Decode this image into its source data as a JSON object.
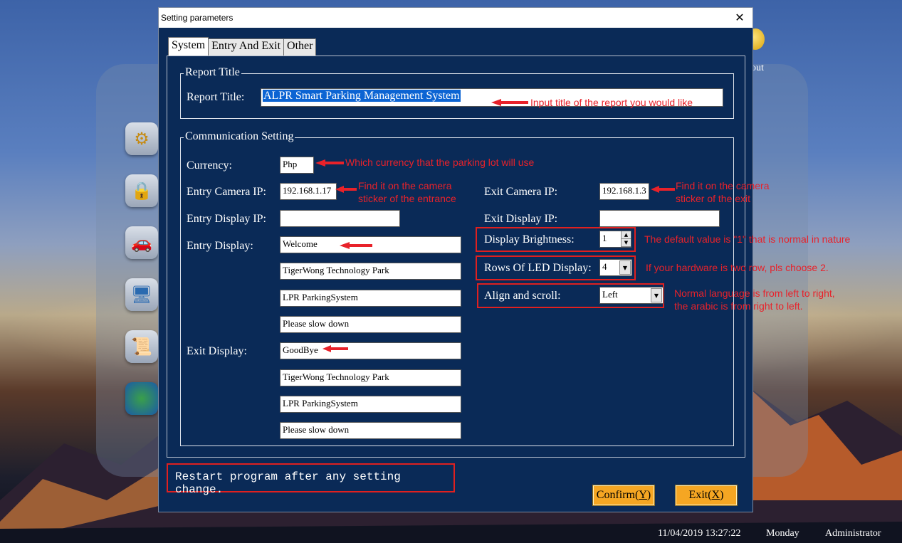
{
  "window": {
    "title": "Setting parameters",
    "close_glyph": "✕"
  },
  "tabs": [
    {
      "label": "System",
      "active": true
    },
    {
      "label": "Entry And Exit",
      "active": false
    },
    {
      "label": "Other",
      "active": false
    }
  ],
  "report": {
    "group_title": "Report Title",
    "label": "Report Title:",
    "value": "ALPR Smart Parking Management System",
    "note": "Input title of the report you would like"
  },
  "comm": {
    "group_title": "Communication Setting",
    "currency_label": "Currency:",
    "currency_value": "Php",
    "currency_note": "Which currency that the parking lot will use",
    "entry_ip_label": "Entry Camera IP:",
    "entry_ip_value": "192.168.1.17",
    "entry_ip_note1": "Find it on the camera",
    "entry_ip_note2": "sticker of the entrance",
    "exit_ip_label": "Exit Camera IP:",
    "exit_ip_value": "192.168.1.3",
    "exit_ip_note1": "Find it on the camera",
    "exit_ip_note2": "sticker of the exit",
    "entry_display_ip_label": "Entry Display IP:",
    "entry_display_ip_value": "",
    "exit_display_ip_label": "Exit Display IP:",
    "exit_display_ip_value": "",
    "entry_display_label": "Entry Display:",
    "entry_display_lines": [
      "Welcome",
      "TigerWong Technology Park",
      "LPR ParkingSystem",
      "Please slow down"
    ],
    "exit_display_label": "Exit Display:",
    "exit_display_lines": [
      "GoodBye",
      "TigerWong Technology Park",
      "LPR ParkingSystem",
      "Please slow down"
    ],
    "brightness_label": "Display Brightness:",
    "brightness_value": "1",
    "brightness_note": "The default value is \"1\" that is normal in nature",
    "rows_label": "Rows Of LED Display:",
    "rows_value": "4",
    "rows_note": "If your hardware is two row, pls choose 2.",
    "align_label": "Align and scroll:",
    "align_value": "Left",
    "align_note1": "Normal language is from left to right,",
    "align_note2": "the arabic is from right to left."
  },
  "footer": {
    "restart_message": "Restart program after any setting change.",
    "confirm_label": "Confirm(",
    "confirm_key": "Y",
    "exit_label": "Exit(",
    "exit_key": "X",
    "close_paren": ")"
  },
  "background": {
    "about_label": "out",
    "icons": [
      "gears-icon",
      "lock-icon",
      "car-icon",
      "monitor-icon",
      "scroll-icon",
      "pie-chart-icon"
    ]
  },
  "statusbar": {
    "datetime": "11/04/2019  13:27:22",
    "weekday": "Monday",
    "user": "Administrator"
  },
  "colors": {
    "dialog_bg": "#0a2a57",
    "annotation_red": "#e8222a",
    "button_orange": "#f5a623",
    "selection_blue": "#0c64d3"
  }
}
